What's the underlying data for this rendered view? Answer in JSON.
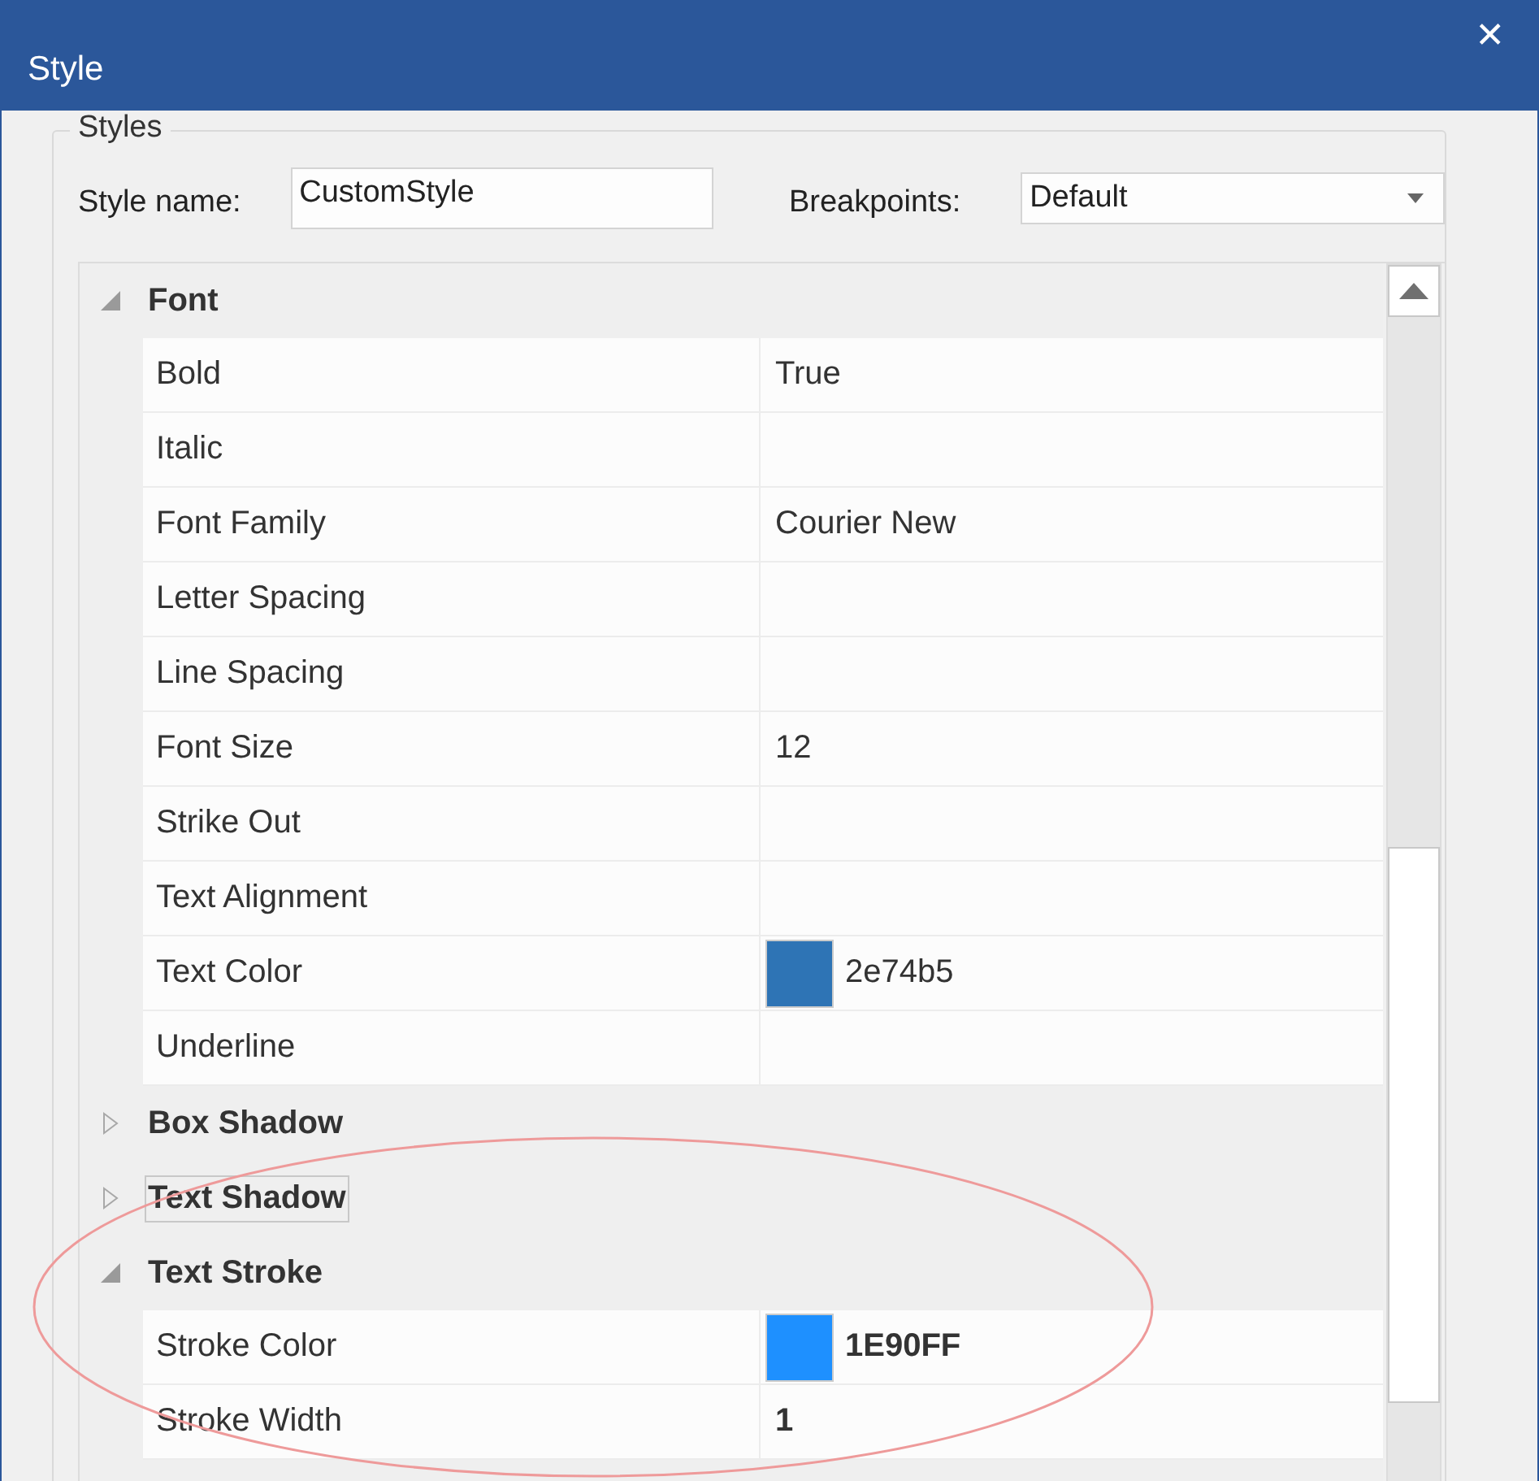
{
  "window": {
    "title": "Style",
    "close": "✕"
  },
  "group": {
    "title": "Styles"
  },
  "style_name": {
    "label": "Style name:",
    "value": "CustomStyle"
  },
  "breakpoints": {
    "label": "Breakpoints:",
    "value": "Default"
  },
  "categories": [
    {
      "name": "Font",
      "expanded": true,
      "focused": false,
      "properties": [
        {
          "name": "Bold",
          "value": "True",
          "bold": false
        },
        {
          "name": "Italic"
        },
        {
          "name": "Font Family",
          "value": "Courier New",
          "bold": false
        },
        {
          "name": "Letter Spacing"
        },
        {
          "name": "Line Spacing"
        },
        {
          "name": "Font Size",
          "value": "12",
          "bold": false
        },
        {
          "name": "Strike Out"
        },
        {
          "name": "Text Alignment"
        },
        {
          "name": "Text Color",
          "value": "2e74b5",
          "color": "#2e74b5",
          "bold": false
        },
        {
          "name": "Underline"
        }
      ]
    },
    {
      "name": "Box Shadow",
      "expanded": false,
      "focused": false
    },
    {
      "name": "Text Shadow",
      "expanded": false,
      "focused": true
    },
    {
      "name": "Text Stroke",
      "expanded": true,
      "focused": false,
      "properties": [
        {
          "name": "Stroke Color",
          "value": "1E90FF",
          "color": "#1e90ff",
          "bold": true
        },
        {
          "name": "Stroke Width",
          "value": "1",
          "bold": true
        }
      ]
    }
  ]
}
